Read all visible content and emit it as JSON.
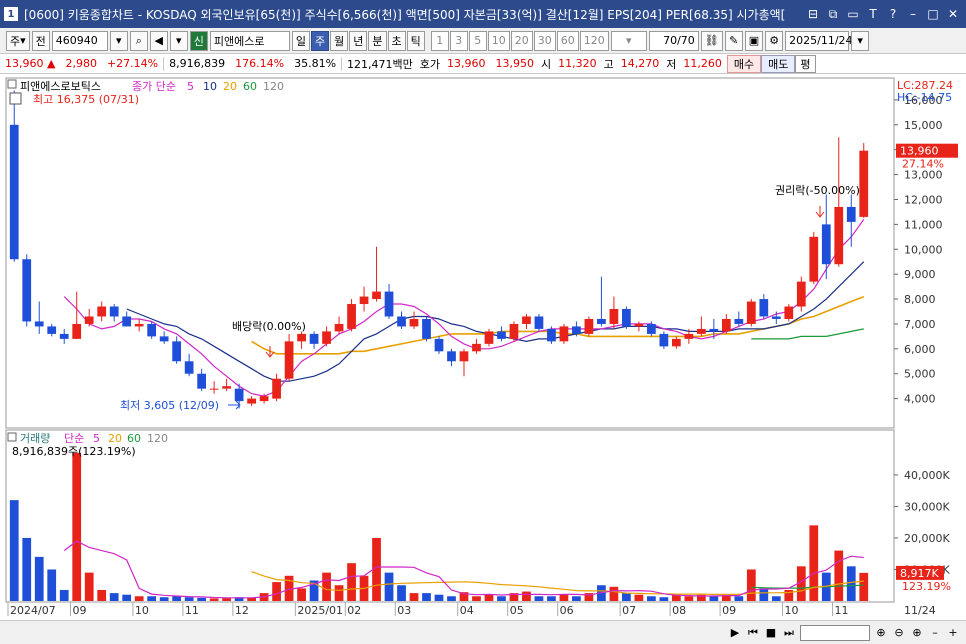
{
  "window": {
    "number": "1",
    "title": "[0600] 키움종합차트 - KOSDAQ 외국인보유[65(천)] 주식수[6,566(천)] 액면[500] 자본금[33(억)] 결산[12월] EPS[204] PER[68.35] 시가총액[",
    "buttons": [
      {
        "name": "layout-icon",
        "glyph": "⊟"
      },
      {
        "name": "copy-window-icon",
        "glyph": "⧉"
      },
      {
        "name": "minimize-icon",
        "glyph": "▭"
      },
      {
        "name": "font-icon",
        "glyph": "T"
      },
      {
        "name": "help-icon",
        "glyph": "?"
      },
      {
        "name": "minimize-window-icon",
        "glyph": "–"
      },
      {
        "name": "maximize-window-icon",
        "glyph": "□"
      },
      {
        "name": "close-window-icon",
        "glyph": "✕"
      }
    ]
  },
  "toolbar": {
    "period_select": "주",
    "prev_label": "전",
    "code": "460940",
    "new_badge": "신",
    "stock_name": "피앤에스로",
    "periods": [
      "일",
      "주",
      "월",
      "년",
      "분",
      "초",
      "틱"
    ],
    "active_period": "주",
    "intervals": [
      "1",
      "3",
      "5",
      "10",
      "20",
      "30",
      "60",
      "120"
    ],
    "count": "70",
    "count_total": "/70",
    "date": "2025/11/24"
  },
  "infobar": {
    "price": "13,960",
    "change_arrow": "▲",
    "change": "2,980",
    "change_pct": "+27.14%",
    "volume": "8,916,839",
    "vol_pct": "176.14%",
    "turnover": "35.81%",
    "amount": "121,471백만",
    "bid_label": "호가",
    "ask": "13,960",
    "bid": "13,950",
    "open_label": "시",
    "open": "11,320",
    "high_label": "고",
    "high": "14,270",
    "low_label": "저",
    "low": "11,260",
    "buy_btn": "매수",
    "sell_btn": "매도",
    "flat_btn": "평"
  },
  "price_panel": {
    "legend_name": "피앤에스로보틱스",
    "legend_ma": "종가 단순",
    "ma_periods": [
      "5",
      "10",
      "20",
      "60",
      "120"
    ],
    "high_note": "최고 16,375 (07/31)",
    "low_note": "최저 3,605 (12/09)",
    "dividend_note": "배당락(0.00%)",
    "rights_note": "권리락(-50.00%)",
    "lc_label": "LC:287.24",
    "hc_label": "HC:-14.75",
    "current_tag": "13,960",
    "current_pct": "27.14%",
    "y_ticks": [
      "16,000",
      "15,000",
      "14,000",
      "13,000",
      "12,000",
      "11,000",
      "10,000",
      "9,000",
      "8,000",
      "7,000",
      "6,000",
      "5,000",
      "4,000"
    ]
  },
  "volume_panel": {
    "legend_name": "거래량",
    "legend_ma": "단순",
    "ma_periods": [
      "5",
      "20",
      "60",
      "120"
    ],
    "value_note": "8,916,839주(123.19%)",
    "current_tag": "8,917K",
    "current_pct": "123.19%",
    "y_ticks": [
      "40,000K",
      "30,000K",
      "20,000K",
      "10,000K"
    ]
  },
  "x_axis": {
    "labels": [
      {
        "text": "2024/07",
        "i": 0
      },
      {
        "text": "09",
        "i": 5
      },
      {
        "text": "10",
        "i": 10
      },
      {
        "text": "11",
        "i": 14
      },
      {
        "text": "12",
        "i": 18
      },
      {
        "text": "2025/01",
        "i": 23
      },
      {
        "text": "02",
        "i": 27
      },
      {
        "text": "03",
        "i": 31
      },
      {
        "text": "04",
        "i": 36
      },
      {
        "text": "05",
        "i": 40
      },
      {
        "text": "06",
        "i": 44
      },
      {
        "text": "07",
        "i": 49
      },
      {
        "text": "08",
        "i": 53
      },
      {
        "text": "09",
        "i": 57
      },
      {
        "text": "10",
        "i": 62
      },
      {
        "text": "11",
        "i": 66
      }
    ],
    "right_label": "11/24"
  },
  "colors": {
    "up": "#e8231a",
    "down": "#1f4fd8",
    "ma5": "#d028c8",
    "ma10": "#1a2f8a",
    "ma20": "#e8a000",
    "ma60": "#1a9a3a",
    "tag": "#e8231a"
  },
  "chart_data": {
    "type": "candlestick",
    "candles": [
      {
        "o": 15000,
        "h": 16375,
        "l": 9500,
        "c": 9600
      },
      {
        "o": 9600,
        "h": 9800,
        "l": 6900,
        "c": 7100
      },
      {
        "o": 7100,
        "h": 7900,
        "l": 6600,
        "c": 6900
      },
      {
        "o": 6900,
        "h": 7000,
        "l": 6500,
        "c": 6600
      },
      {
        "o": 6600,
        "h": 6800,
        "l": 6200,
        "c": 6400
      },
      {
        "o": 6400,
        "h": 8300,
        "l": 6400,
        "c": 7000
      },
      {
        "o": 7000,
        "h": 7600,
        "l": 6900,
        "c": 7300
      },
      {
        "o": 7300,
        "h": 7900,
        "l": 7100,
        "c": 7700
      },
      {
        "o": 7700,
        "h": 7800,
        "l": 7100,
        "c": 7300
      },
      {
        "o": 7300,
        "h": 7500,
        "l": 6900,
        "c": 6900
      },
      {
        "o": 6900,
        "h": 7200,
        "l": 6700,
        "c": 7000
      },
      {
        "o": 7000,
        "h": 7100,
        "l": 6400,
        "c": 6500
      },
      {
        "o": 6500,
        "h": 6700,
        "l": 6200,
        "c": 6300
      },
      {
        "o": 6300,
        "h": 6500,
        "l": 5400,
        "c": 5500
      },
      {
        "o": 5500,
        "h": 5800,
        "l": 4900,
        "c": 5000
      },
      {
        "o": 5000,
        "h": 5200,
        "l": 4300,
        "c": 4400
      },
      {
        "o": 4400,
        "h": 4700,
        "l": 4200,
        "c": 4400
      },
      {
        "o": 4400,
        "h": 4800,
        "l": 4300,
        "c": 4500
      },
      {
        "o": 4400,
        "h": 4600,
        "l": 3605,
        "c": 3900
      },
      {
        "o": 3800,
        "h": 4100,
        "l": 3700,
        "c": 4000
      },
      {
        "o": 3900,
        "h": 4200,
        "l": 3800,
        "c": 4100
      },
      {
        "o": 4000,
        "h": 5000,
        "l": 3900,
        "c": 4800
      },
      {
        "o": 4800,
        "h": 6600,
        "l": 4700,
        "c": 6300
      },
      {
        "o": 6300,
        "h": 6700,
        "l": 6000,
        "c": 6600
      },
      {
        "o": 6600,
        "h": 6700,
        "l": 6000,
        "c": 6200
      },
      {
        "o": 6200,
        "h": 6900,
        "l": 6100,
        "c": 6700
      },
      {
        "o": 6700,
        "h": 7300,
        "l": 6600,
        "c": 7000
      },
      {
        "o": 6800,
        "h": 8000,
        "l": 6700,
        "c": 7800
      },
      {
        "o": 7800,
        "h": 8500,
        "l": 7500,
        "c": 8100
      },
      {
        "o": 8000,
        "h": 10100,
        "l": 7900,
        "c": 8300
      },
      {
        "o": 8300,
        "h": 8600,
        "l": 7200,
        "c": 7300
      },
      {
        "o": 7300,
        "h": 7500,
        "l": 6800,
        "c": 6900
      },
      {
        "o": 6900,
        "h": 7500,
        "l": 6800,
        "c": 7200
      },
      {
        "o": 7200,
        "h": 7300,
        "l": 6300,
        "c": 6400
      },
      {
        "o": 6400,
        "h": 6500,
        "l": 5800,
        "c": 5900
      },
      {
        "o": 5900,
        "h": 6000,
        "l": 5300,
        "c": 5500
      },
      {
        "o": 5500,
        "h": 6000,
        "l": 4900,
        "c": 5900
      },
      {
        "o": 5900,
        "h": 6400,
        "l": 5800,
        "c": 6200
      },
      {
        "o": 6200,
        "h": 6800,
        "l": 6100,
        "c": 6700
      },
      {
        "o": 6700,
        "h": 6900,
        "l": 6300,
        "c": 6400
      },
      {
        "o": 6400,
        "h": 7100,
        "l": 6300,
        "c": 7000
      },
      {
        "o": 7000,
        "h": 7400,
        "l": 6800,
        "c": 7300
      },
      {
        "o": 7300,
        "h": 7400,
        "l": 6700,
        "c": 6800
      },
      {
        "o": 6800,
        "h": 6900,
        "l": 6200,
        "c": 6300
      },
      {
        "o": 6300,
        "h": 7000,
        "l": 6200,
        "c": 6900
      },
      {
        "o": 6900,
        "h": 7100,
        "l": 6500,
        "c": 6600
      },
      {
        "o": 6600,
        "h": 7300,
        "l": 6500,
        "c": 7200
      },
      {
        "o": 7200,
        "h": 8900,
        "l": 6900,
        "c": 7000
      },
      {
        "o": 7000,
        "h": 8100,
        "l": 6800,
        "c": 7600
      },
      {
        "o": 7600,
        "h": 7700,
        "l": 6800,
        "c": 6900
      },
      {
        "o": 6900,
        "h": 7100,
        "l": 6700,
        "c": 7000
      },
      {
        "o": 7000,
        "h": 7100,
        "l": 6500,
        "c": 6600
      },
      {
        "o": 6600,
        "h": 6700,
        "l": 6000,
        "c": 6100
      },
      {
        "o": 6100,
        "h": 6500,
        "l": 6000,
        "c": 6400
      },
      {
        "o": 6400,
        "h": 6800,
        "l": 6200,
        "c": 6600
      },
      {
        "o": 6600,
        "h": 7300,
        "l": 6500,
        "c": 6800
      },
      {
        "o": 6800,
        "h": 7200,
        "l": 6400,
        "c": 6700
      },
      {
        "o": 6700,
        "h": 7400,
        "l": 6600,
        "c": 7200
      },
      {
        "o": 7200,
        "h": 7500,
        "l": 6900,
        "c": 7000
      },
      {
        "o": 7000,
        "h": 8000,
        "l": 6900,
        "c": 7900
      },
      {
        "o": 8000,
        "h": 8200,
        "l": 7200,
        "c": 7300
      },
      {
        "o": 7300,
        "h": 7500,
        "l": 7000,
        "c": 7200
      },
      {
        "o": 7200,
        "h": 7800,
        "l": 7100,
        "c": 7700
      },
      {
        "o": 7700,
        "h": 8900,
        "l": 7500,
        "c": 8700
      },
      {
        "o": 8700,
        "h": 10700,
        "l": 8600,
        "c": 10500
      },
      {
        "o": 11000,
        "h": 12200,
        "l": 8800,
        "c": 9400
      },
      {
        "o": 9400,
        "h": 14500,
        "l": 9300,
        "c": 11700
      },
      {
        "o": 11700,
        "h": 12200,
        "l": 10100,
        "c": 11100
      },
      {
        "o": 11300,
        "h": 14270,
        "l": 11260,
        "c": 13960
      }
    ],
    "ma5": [
      null,
      null,
      null,
      null,
      8100,
      7600,
      7000,
      6800,
      6900,
      7200,
      7200,
      7100,
      6800,
      6600,
      6200,
      5800,
      5300,
      4900,
      4500,
      4200,
      4100,
      4300,
      4900,
      5500,
      5800,
      6200,
      6600,
      6800,
      7100,
      7500,
      7800,
      7800,
      7700,
      7400,
      7000,
      6500,
      6200,
      6000,
      6000,
      6100,
      6300,
      6500,
      6700,
      6800,
      6800,
      6800,
      6800,
      6800,
      6900,
      7000,
      7000,
      7000,
      6800,
      6700,
      6500,
      6400,
      6500,
      6700,
      6900,
      7100,
      7200,
      7400,
      7500,
      7900,
      8400,
      9200,
      10000,
      10500,
      11200
    ],
    "ma10": [
      null,
      null,
      null,
      null,
      null,
      null,
      null,
      null,
      null,
      7600,
      7400,
      7200,
      7000,
      6900,
      6600,
      6400,
      6100,
      5800,
      5500,
      5200,
      4900,
      4700,
      4700,
      4800,
      4900,
      5100,
      5400,
      5900,
      6400,
      6600,
      6900,
      7200,
      7300,
      7300,
      7200,
      7000,
      6900,
      6700,
      6600,
      6500,
      6400,
      6300,
      6400,
      6400,
      6500,
      6600,
      6700,
      6800,
      6800,
      6900,
      6900,
      6900,
      6800,
      6800,
      6700,
      6700,
      6700,
      6700,
      6800,
      6800,
      6800,
      6900,
      7000,
      7300,
      7600,
      8000,
      8500,
      9000,
      9500
    ],
    "ma20": [
      null,
      null,
      null,
      null,
      null,
      null,
      null,
      null,
      null,
      null,
      null,
      null,
      null,
      null,
      null,
      null,
      null,
      null,
      null,
      6300,
      6000,
      5800,
      5800,
      5800,
      5800,
      5800,
      5800,
      5900,
      5900,
      6000,
      6100,
      6200,
      6300,
      6400,
      6500,
      6600,
      6600,
      6600,
      6600,
      6700,
      6700,
      6700,
      6700,
      6700,
      6600,
      6600,
      6500,
      6500,
      6500,
      6500,
      6500,
      6500,
      6500,
      6500,
      6500,
      6500,
      6600,
      6600,
      6600,
      6700,
      6800,
      6900,
      7000,
      7200,
      7300,
      7500,
      7700,
      7900,
      8100
    ],
    "ma60": [
      null,
      null,
      null,
      null,
      null,
      null,
      null,
      null,
      null,
      null,
      null,
      null,
      null,
      null,
      null,
      null,
      null,
      null,
      null,
      null,
      null,
      null,
      null,
      null,
      null,
      null,
      null,
      null,
      null,
      null,
      null,
      null,
      null,
      null,
      null,
      null,
      null,
      null,
      null,
      null,
      null,
      null,
      null,
      null,
      null,
      null,
      null,
      null,
      null,
      null,
      null,
      null,
      null,
      null,
      null,
      null,
      null,
      null,
      null,
      6400,
      6400,
      6400,
      6400,
      6500,
      6500,
      6500,
      6600,
      6700,
      6800
    ],
    "volume": [
      32000,
      20000,
      14000,
      10000,
      3500,
      47000,
      9000,
      3500,
      2500,
      2000,
      1500,
      1500,
      1200,
      1500,
      1200,
      1000,
      800,
      900,
      1200,
      1000,
      2500,
      6000,
      8000,
      4000,
      6500,
      9000,
      5000,
      12000,
      8000,
      20000,
      9000,
      5000,
      2500,
      2500,
      2000,
      1500,
      2800,
      1500,
      2000,
      1500,
      2500,
      3000,
      1500,
      1500,
      2200,
      1500,
      2500,
      5000,
      4500,
      2500,
      2000,
      1500,
      1200,
      2000,
      1500,
      2000,
      1500,
      2000,
      1500,
      10000,
      4000,
      1500,
      3500,
      11000,
      24000,
      9000,
      16000,
      11000,
      8917
    ],
    "vol_ma5": [
      null,
      null,
      null,
      null,
      16000,
      19000,
      17000,
      16000,
      15000,
      13000,
      4000,
      2200,
      1800,
      1600,
      1400,
      1300,
      1100,
      1000,
      1000,
      1000,
      1300,
      2300,
      3700,
      4300,
      5400,
      6700,
      6500,
      7800,
      8000,
      10800,
      10800,
      10800,
      10700,
      8900,
      7700,
      3500,
      2300,
      2000,
      2100,
      1900,
      2100,
      2100,
      2100,
      2000,
      2100,
      2100,
      1900,
      2600,
      3300,
      3200,
      3300,
      3100,
      2300,
      1800,
      1700,
      1600,
      1600,
      1700,
      1700,
      3400,
      3800,
      3800,
      4100,
      6100,
      8800,
      9800,
      12700,
      14200,
      13800
    ],
    "vol_ma20": [
      null,
      null,
      null,
      null,
      null,
      null,
      null,
      null,
      null,
      null,
      null,
      null,
      null,
      null,
      null,
      null,
      null,
      null,
      null,
      9300,
      7900,
      6800,
      6500,
      5800,
      5600,
      3600,
      3400,
      3800,
      4000,
      5000,
      5400,
      5600,
      5700,
      5800,
      5900,
      6000,
      6100,
      5900,
      5600,
      5200,
      5000,
      4800,
      4500,
      4100,
      3700,
      3300,
      3200,
      3200,
      3000,
      2500,
      2400,
      2300,
      2300,
      2200,
      2200,
      2200,
      2100,
      2100,
      2100,
      2500,
      2600,
      2600,
      2700,
      3200,
      4300,
      4700,
      5400,
      5900,
      6300
    ],
    "vol_ma60": [
      null,
      null,
      null,
      null,
      null,
      null,
      null,
      null,
      null,
      null,
      null,
      null,
      null,
      null,
      null,
      null,
      null,
      null,
      null,
      null,
      null,
      null,
      null,
      null,
      null,
      null,
      null,
      null,
      null,
      null,
      null,
      null,
      null,
      null,
      null,
      null,
      null,
      null,
      null,
      null,
      null,
      null,
      null,
      null,
      null,
      null,
      null,
      null,
      null,
      null,
      null,
      null,
      null,
      null,
      null,
      null,
      null,
      null,
      null,
      4300,
      4200,
      4100,
      4100,
      4100,
      4400,
      4500,
      4700,
      4900,
      5000
    ],
    "price_range": [
      2900,
      16800
    ],
    "volume_range": [
      0,
      46000
    ]
  },
  "bottombar": {
    "buttons": [
      "▶",
      "⏮",
      "■",
      "⏭",
      "",
      "⊕",
      "⊖",
      "⊕",
      "–",
      "+"
    ]
  }
}
